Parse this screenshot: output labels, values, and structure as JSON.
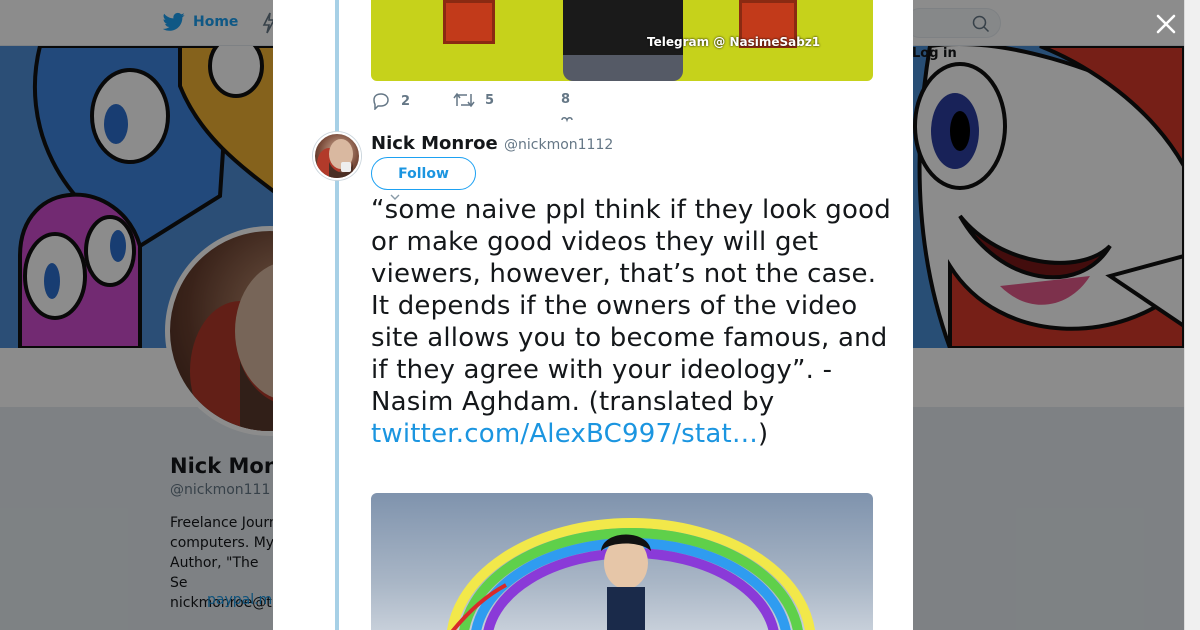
{
  "nav": {
    "home_label": "Home",
    "login_label": "Log in"
  },
  "profile": {
    "name": "Nick Mon",
    "handle": "@nickmon111",
    "bio": "Freelance Journ\ncomputers. My\nAuthor, \"The Se\nnickmonroe@t",
    "link": "paypal.m"
  },
  "modal": {
    "prev_tweet": {
      "watermark": "Telegram @ NasimeSabz1",
      "replies": "2",
      "retweets": "5",
      "likes": "8"
    },
    "tweet": {
      "name": "Nick Monroe",
      "handle": "@nickmon1112",
      "follow_label": "Follow",
      "text_before_link": "“some naive ppl think if they look good or make good videos they will get viewers, however, that’s not the case. It depends if the owners of the video site allows you to become famous, and if they agree with your ideology”.  - Nasim Aghdam. (translated by ",
      "link_text": "twitter.com/AlexBC997/stat…",
      "text_after_link": ")"
    }
  },
  "colors": {
    "twitter_blue": "#1da1f2",
    "link_blue": "#1b95e0",
    "thread_line": "#a7d0e6"
  },
  "icons": [
    "twitter-bird-icon",
    "moments-icon",
    "search-icon",
    "close-icon",
    "reply-icon",
    "retweet-icon",
    "like-icon",
    "chevron-down-icon"
  ]
}
